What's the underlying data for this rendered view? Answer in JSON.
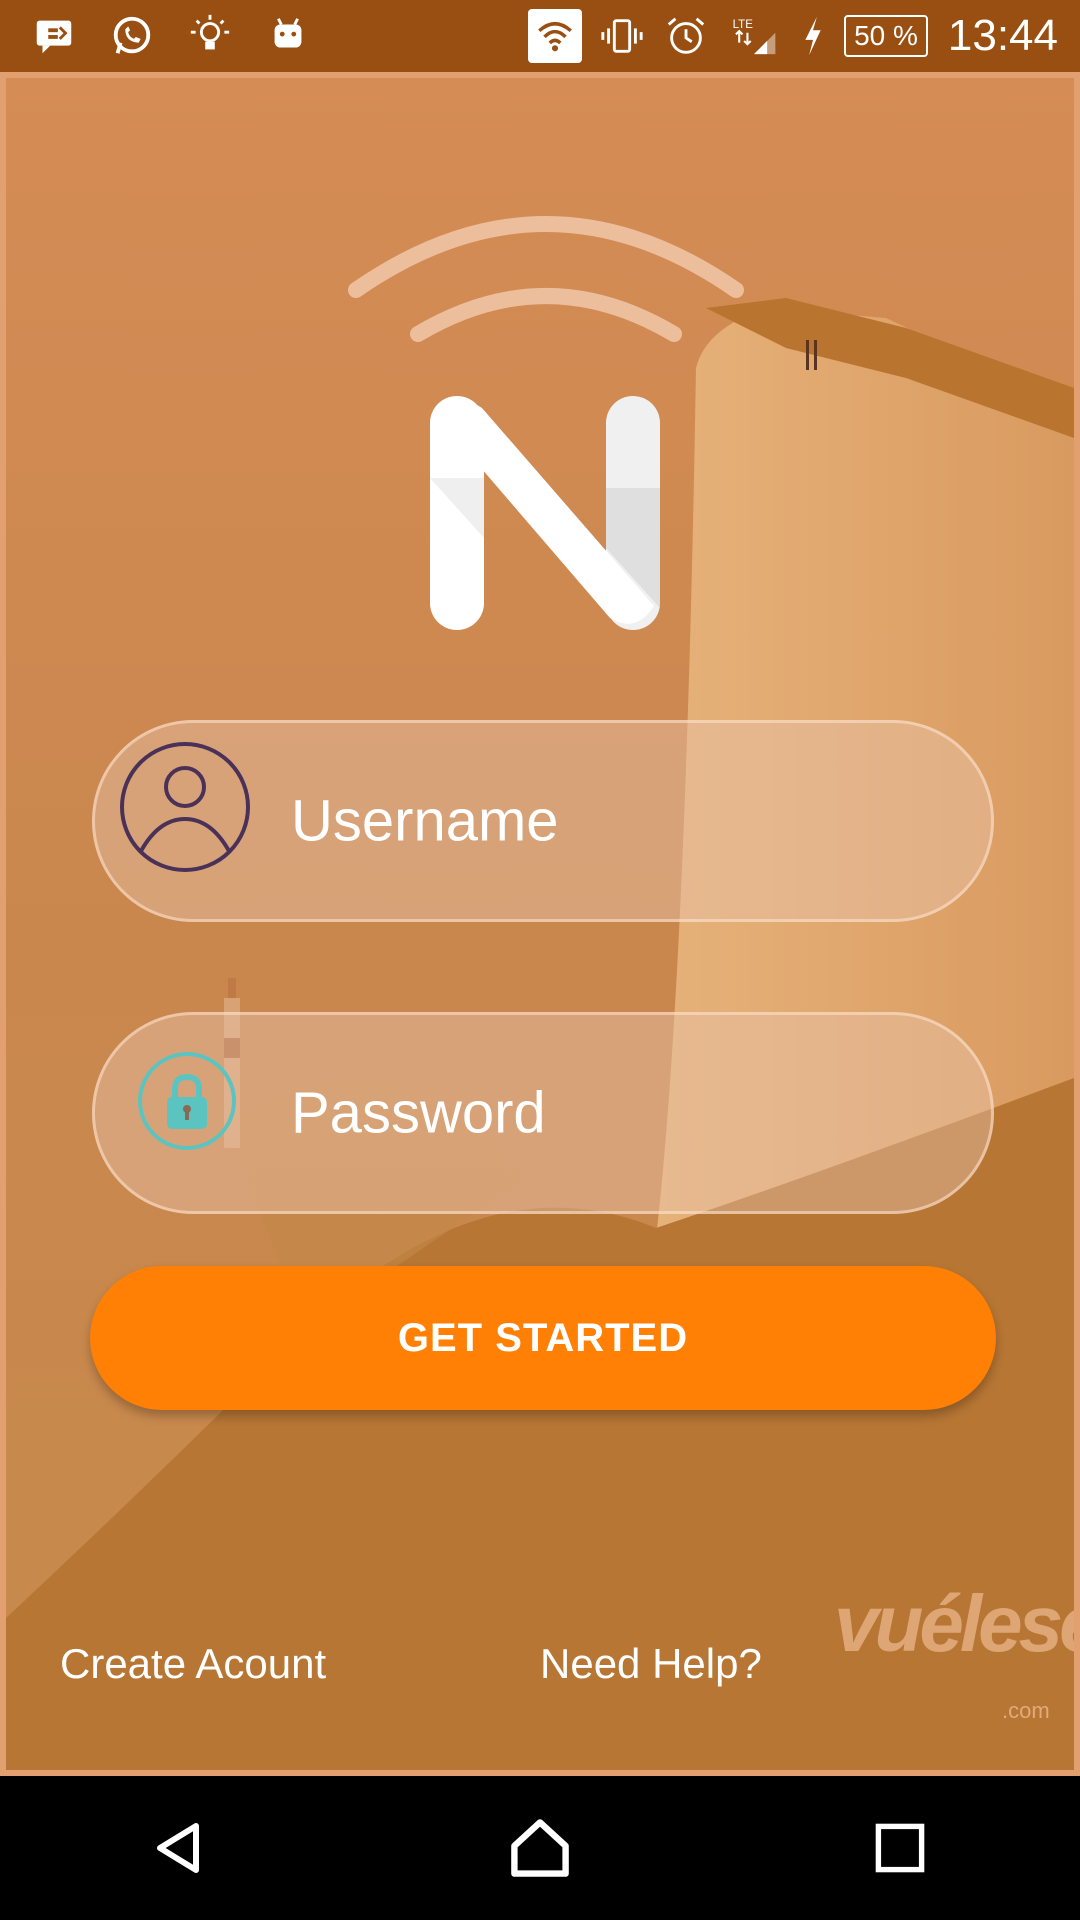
{
  "status_bar": {
    "battery": "50 %",
    "time": "13:44",
    "network": "LTE",
    "icons": [
      "message-icon",
      "whatsapp-icon",
      "lightbulb-icon",
      "android-icon",
      "wifi-icon",
      "vibrate-icon",
      "alarm-icon",
      "signal-icon",
      "charging-icon"
    ]
  },
  "logo": {
    "letter": "N"
  },
  "login": {
    "username_placeholder": "Username",
    "password_placeholder": "Password",
    "submit_label": "GET STARTED"
  },
  "links": {
    "create_account": "Create Acount",
    "help": "Need Help?"
  },
  "watermark": {
    "text": "vuélese",
    "domain": ".com"
  },
  "colors": {
    "status_bar": "#9a4f12",
    "accent": "#ff8005",
    "background_tint": "#c8834a",
    "username_icon": "#4a3158",
    "password_icon": "#5bc4c0"
  },
  "nav": {
    "back": "back-icon",
    "home": "home-icon",
    "recents": "recents-icon"
  }
}
